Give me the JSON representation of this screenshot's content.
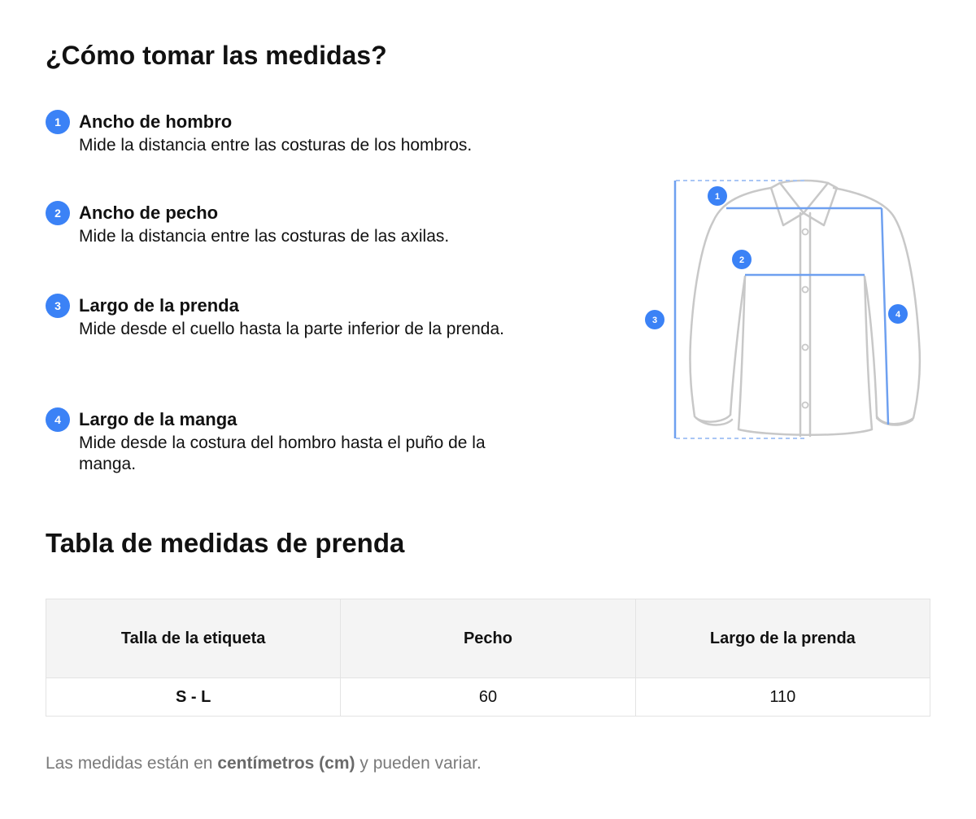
{
  "title": "¿Cómo tomar las medidas?",
  "steps": [
    {
      "number": "1",
      "title": "Ancho de hombro",
      "description": "Mide la distancia entre las costuras de los hombros."
    },
    {
      "number": "2",
      "title": "Ancho de pecho",
      "description": "Mide la distancia entre las costuras de las axilas."
    },
    {
      "number": "3",
      "title": "Largo de la prenda",
      "description": "Mide desde el cuello hasta la parte inferior de la prenda."
    },
    {
      "number": "4",
      "title": "Largo de la manga",
      "description": "Mide desde la costura del hombro hasta el puño de la manga."
    }
  ],
  "illustration": {
    "markers": [
      "1",
      "2",
      "3",
      "4"
    ],
    "accent_color": "#3b82f6",
    "outline_color": "#c8c8c8"
  },
  "table": {
    "title": "Tabla de medidas de prenda",
    "headers": [
      "Talla de la etiqueta",
      "Pecho",
      "Largo de la prenda"
    ],
    "rows": [
      [
        "S - L",
        "60",
        "110"
      ]
    ]
  },
  "note": {
    "prefix": "Las medidas están en ",
    "emphasis": "centímetros (cm)",
    "suffix": " y pueden variar."
  }
}
